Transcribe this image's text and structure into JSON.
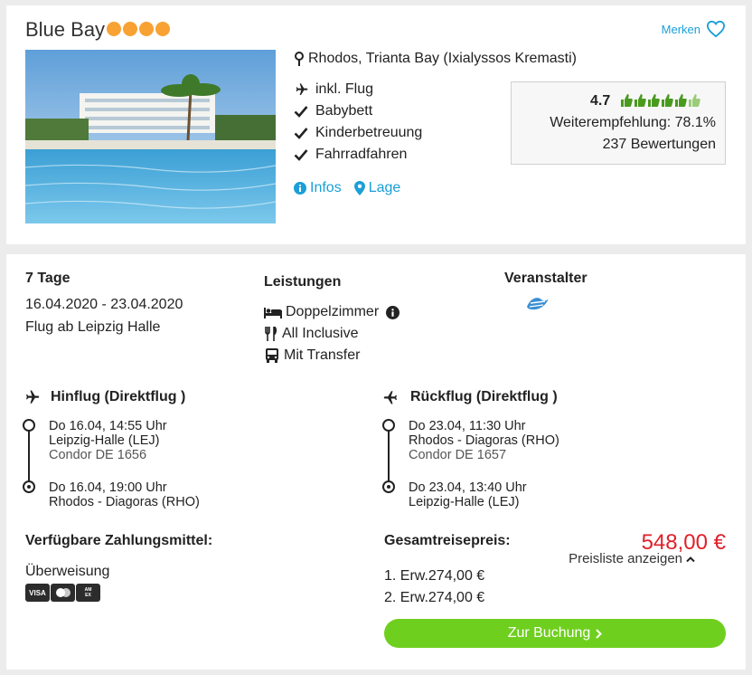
{
  "hotel": {
    "name": "Blue Bay",
    "stars": 4,
    "merken_label": "Merken",
    "location": "Rhodos, Trianta Bay (Ixialyssos Kremasti)",
    "features": [
      "inkl. Flug",
      "Babybett",
      "Kinderbetreuung",
      "Fahrradfahren"
    ],
    "links": {
      "infos": "Infos",
      "lage": "Lage"
    },
    "rating": {
      "score": "4.7",
      "thumbs": 5.5,
      "recommendation": "Weiterempfehlung: 78.1%",
      "reviews": "237 Bewertungen"
    }
  },
  "offer": {
    "duration": "7 Tage",
    "dates": "16.04.2020 - 23.04.2020",
    "departure": "Flug ab Leipzig Halle",
    "leistungen_title": "Leistungen",
    "leistungen": [
      "Doppelzimmer",
      "All Inclusive",
      "Mit Transfer"
    ],
    "veranstalter_title": "Veranstalter",
    "hinflug": {
      "title": "Hinflug (Direktflug )",
      "dep_time": "Do 16.04, 14:55 Uhr",
      "dep_airport": "Leipzig-Halle (LEJ)",
      "flight_no": "Condor DE 1656",
      "arr_time": "Do 16.04, 19:00 Uhr",
      "arr_airport": "Rhodos - Diagoras (RHO)"
    },
    "rueckflug": {
      "title": "Rückflug (Direktflug )",
      "dep_time": "Do 23.04, 11:30 Uhr",
      "dep_airport": "Rhodos - Diagoras (RHO)",
      "flight_no": "Condor DE 1657",
      "arr_time": "Do 23.04, 13:40 Uhr",
      "arr_airport": "Leipzig-Halle (LEJ)"
    },
    "payment_title": "Verfügbare Zahlungsmittel:",
    "payment_method": "Überweisung",
    "payment_cards": [
      "VISA",
      "Mastercard",
      "American Express"
    ],
    "total_title": "Gesamtreisepreis:",
    "total_price": "548,00 €",
    "price_list_label": "Preisliste anzeigen",
    "travellers": [
      "1. Erw.274,00 €",
      "2. Erw.274,00 €"
    ],
    "cta_label": "Zur Buchung"
  },
  "colors": {
    "accent_blue": "#1a9fd8",
    "star_orange": "#f7a233",
    "thumb_green": "#4a9a1f",
    "price_red": "#e0202a",
    "cta_green": "#6fcf1e"
  }
}
